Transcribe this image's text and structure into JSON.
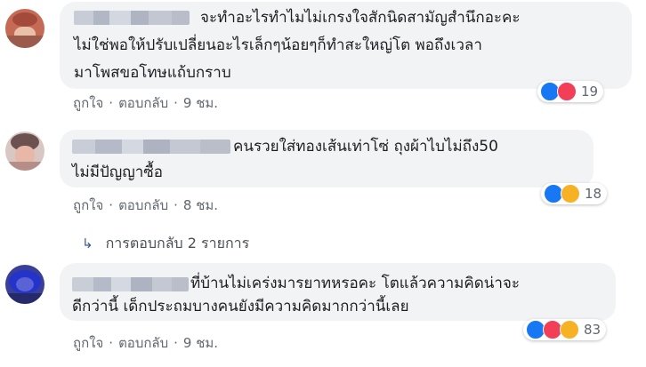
{
  "comments": [
    {
      "lines": [
        "จะทำอะไรทำไมไม่เกรงใจสักนิดสามัญสำนึกอะคะ",
        "ไม่ใช่พอให้ปรับเปลี่ยนอะไรเล็กๆน้อยๆก็ทำสะใหญ่โต พอถึงเวลา",
        "มาโพสขอโทษแถ้บกราบ"
      ],
      "like_label": "ถูกใจ",
      "reply_label": "ตอบกลับ",
      "time": "9 ชม.",
      "reactions": [
        "like-icon",
        "love-icon"
      ],
      "reaction_count": "19"
    },
    {
      "lines": [
        "คนรวยใส่ทองเส้นเท่าโซ่ ถุงผ้าไบไม่ถึง50",
        "ไม่มีปัญญาซื้อ"
      ],
      "like_label": "ถูกใจ",
      "reply_label": "ตอบกลับ",
      "time": "8 ชม.",
      "reactions": [
        "like-icon",
        "haha-icon"
      ],
      "reaction_count": "18",
      "replies_link": "การตอบกลับ 2 รายการ"
    },
    {
      "lines": [
        "ที่บ้านไม่เคร่งมารยาทหรอคะ โตแล้วความคิดน่าจะ",
        "ดีกว่านี้ เด็กประถมบางคนยังมีความคิดมากกว่านี้เลย"
      ],
      "like_label": "ถูกใจ",
      "reply_label": "ตอบกลับ",
      "time": "9 ชม.",
      "reactions": [
        "like-icon",
        "love-icon",
        "haha-icon"
      ],
      "reaction_count": "83"
    }
  ],
  "colors": {
    "bubble": "#f2f3f5",
    "action_text": "#606770",
    "link_arrow": "#385898",
    "like": "#1877f2",
    "love": "#f33e58",
    "haha": "#f7b125"
  }
}
